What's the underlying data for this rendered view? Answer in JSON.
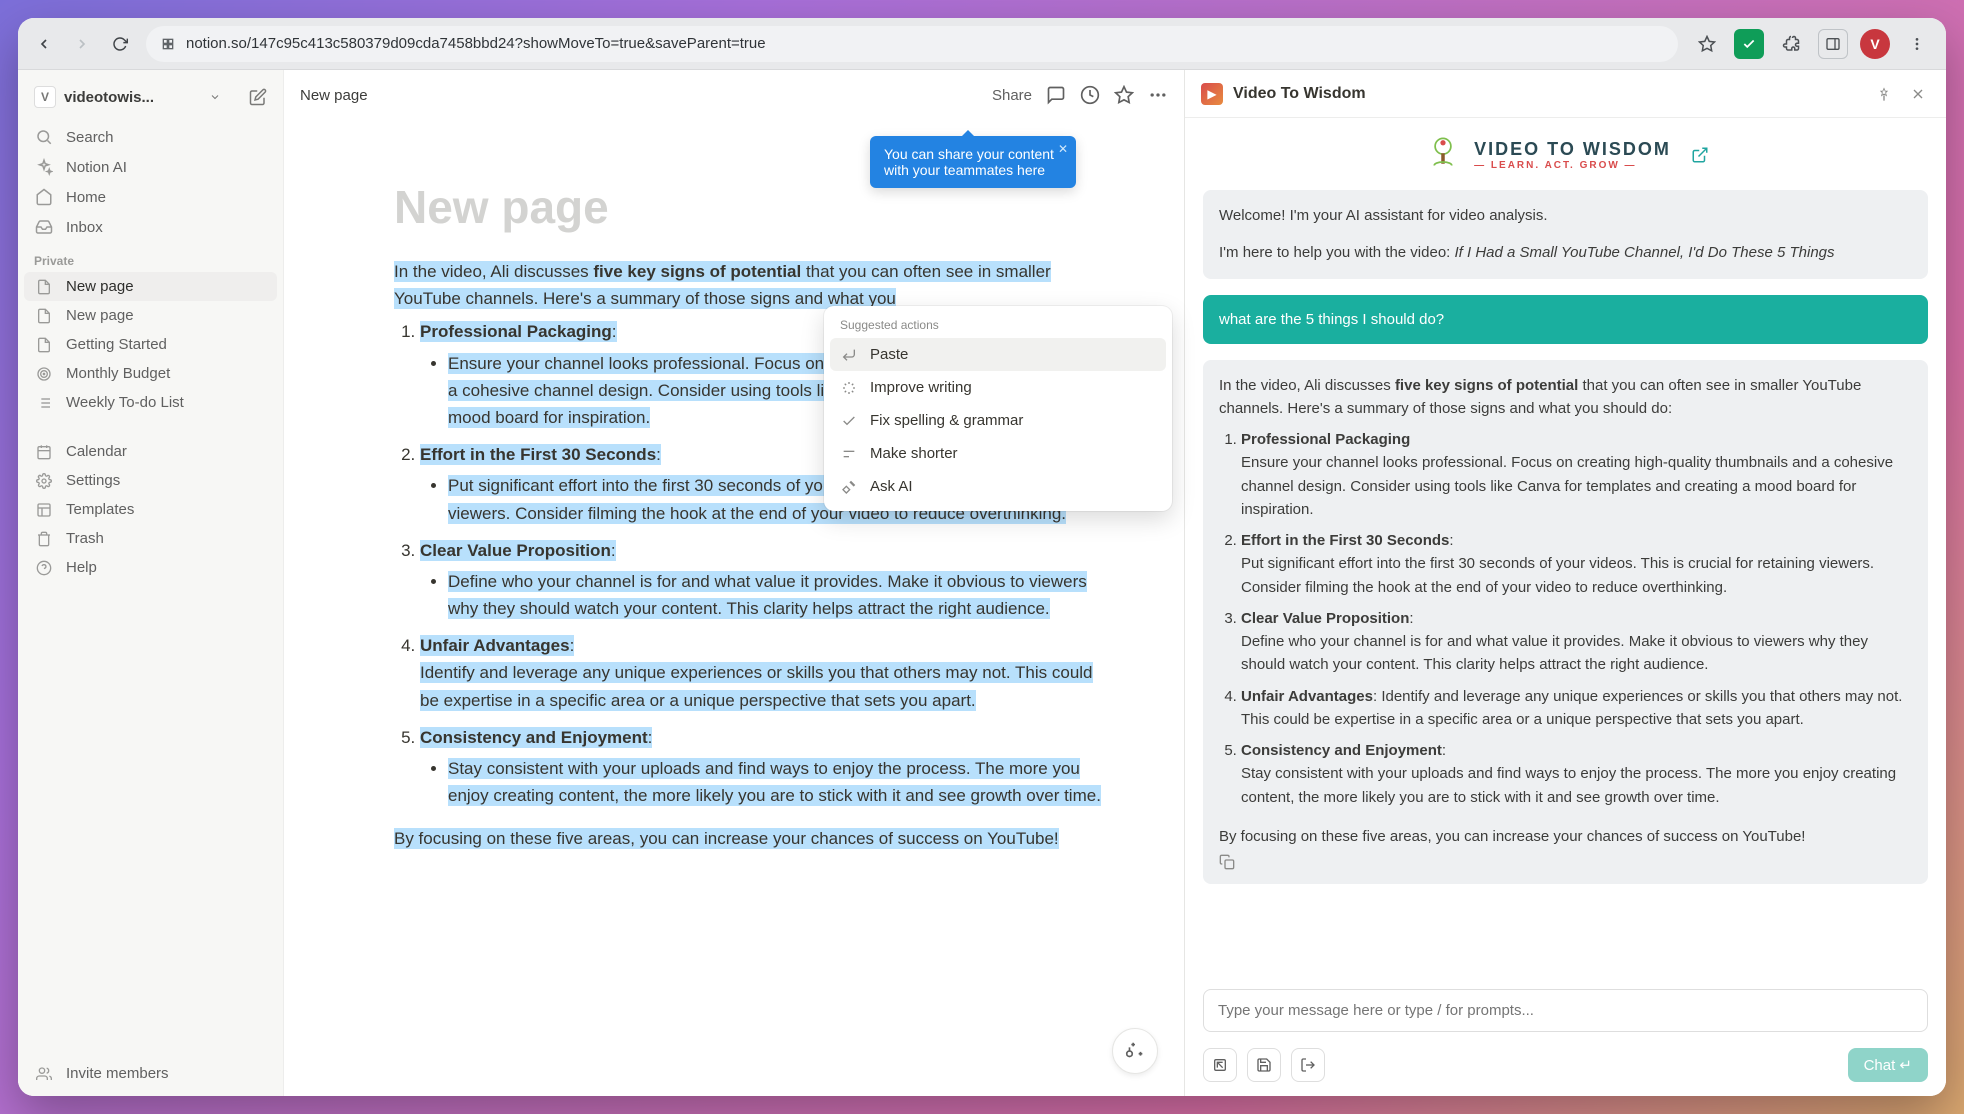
{
  "browser": {
    "url": "notion.so/147c95c413c580379d09cda7458bbd24?showMoveTo=true&saveParent=true",
    "avatar_initial": "V"
  },
  "workspace": {
    "badge": "V",
    "name": "videotowis..."
  },
  "sidebar": {
    "top": [
      {
        "icon": "search",
        "label": "Search"
      },
      {
        "icon": "sparkles",
        "label": "Notion AI"
      },
      {
        "icon": "home",
        "label": "Home"
      },
      {
        "icon": "inbox",
        "label": "Inbox"
      }
    ],
    "section_private": "Private",
    "private": [
      {
        "icon": "doc",
        "label": "New page",
        "active": true
      },
      {
        "icon": "doc",
        "label": "New page"
      },
      {
        "icon": "doc",
        "label": "Getting Started"
      },
      {
        "icon": "target",
        "label": "Monthly Budget"
      },
      {
        "icon": "list",
        "label": "Weekly To-do List"
      }
    ],
    "bottom": [
      {
        "icon": "calendar",
        "label": "Calendar"
      },
      {
        "icon": "gear",
        "label": "Settings"
      },
      {
        "icon": "templates",
        "label": "Templates"
      },
      {
        "icon": "trash",
        "label": "Trash"
      },
      {
        "icon": "help",
        "label": "Help"
      }
    ],
    "invite": "Invite members"
  },
  "topbar": {
    "crumb": "New page",
    "share": "Share"
  },
  "share_tip": {
    "text": "You can share your content with your teammates here"
  },
  "page": {
    "title": "New page",
    "intro_pre": "In the video, Ali discusses ",
    "intro_strong": "five key signs of potential",
    "intro_post": " that you can often see in smaller YouTube channels. Here's a summary of those signs and what you",
    "signs": [
      {
        "head": "Professional Packaging",
        "colon": ":",
        "sub": "Ensure your channel looks professional. Focus on creating high-quality thumbnails and a cohesive channel design. Consider using tools like Canva for templates and creating a mood board for inspiration."
      },
      {
        "head": "Effort in the First 30 Seconds",
        "colon": ":",
        "sub": "Put significant effort into the first 30 seconds of your videos. This is crucial for retaining viewers. Consider filming the hook at the end of your video to reduce overthinking."
      },
      {
        "head": "Clear Value Proposition",
        "colon": ":",
        "sub": "Define who your channel is for and what value it provides. Make it obvious to viewers why they should watch your content. This clarity helps attract the right audience."
      },
      {
        "head": "Unfair Advantages",
        "colon": ":",
        "body": "Identify and leverage any unique experiences or skills you that others may not. This could be expertise in a specific area or a unique perspective that sets you apart."
      },
      {
        "head": "Consistency and Enjoyment",
        "colon": ":",
        "sub": "Stay consistent with your uploads and find ways to enjoy the process. The more you enjoy creating content, the more likely you are to stick with it and see growth over time."
      }
    ],
    "outro": "By focusing on these five areas, you can increase your chances of success on YouTube!"
  },
  "suggest": {
    "header": "Suggested actions",
    "items": [
      {
        "icon": "paste",
        "label": "Paste",
        "sel": true
      },
      {
        "icon": "improve",
        "label": "Improve writing"
      },
      {
        "icon": "check",
        "label": "Fix spelling & grammar"
      },
      {
        "icon": "shorter",
        "label": "Make shorter"
      },
      {
        "icon": "ask",
        "label": "Ask AI"
      }
    ]
  },
  "extension": {
    "title": "Video To Wisdom",
    "brand_main": "VIDEO TO WISDOM",
    "brand_sub": "— LEARN. ACT. GROW —",
    "welcome_1": "Welcome! I'm your AI assistant for video analysis.",
    "welcome_2_pre": "I'm here to help you with the video: ",
    "welcome_2_em": "If I Had a Small YouTube Channel, I'd Do These 5 Things",
    "user_msg": "what are the 5 things I should do?",
    "resp_intro_pre": "In the video, Ali discusses ",
    "resp_intro_strong": "five key signs of potential",
    "resp_intro_post": " that you can often see in smaller YouTube channels. Here's a summary of those signs and what you should do:",
    "resp_items": [
      {
        "head": "Professional Packaging",
        "body": "Ensure your channel looks professional. Focus on creating high-quality thumbnails and a cohesive channel design. Consider using tools like Canva for templates and creating a mood board for inspiration."
      },
      {
        "head": "Effort in the First 30 Seconds",
        "colon": ":",
        "body": "Put significant effort into the first 30 seconds of your videos. This is crucial for retaining viewers. Consider filming the hook at the end of your video to reduce overthinking."
      },
      {
        "head": "Clear Value Proposition",
        "colon": ":",
        "body": "Define who your channel is for and what value it provides. Make it obvious to viewers why they should watch your content. This clarity helps attract the right audience."
      },
      {
        "head": "Unfair Advantages",
        "inline": ": Identify and leverage any unique experiences or skills you that others may not. This could be expertise in a specific area or a unique perspective that sets you apart."
      },
      {
        "head": "Consistency and Enjoyment",
        "colon": ":",
        "body": "Stay consistent with your uploads and find ways to enjoy the process. The more you enjoy creating content, the more likely you are to stick with it and see growth over time."
      }
    ],
    "resp_outro": "By focusing on these five areas, you can increase your chances of success on YouTube!",
    "input_placeholder": "Type your message here or type / for prompts...",
    "chat_btn": "Chat ↵"
  }
}
